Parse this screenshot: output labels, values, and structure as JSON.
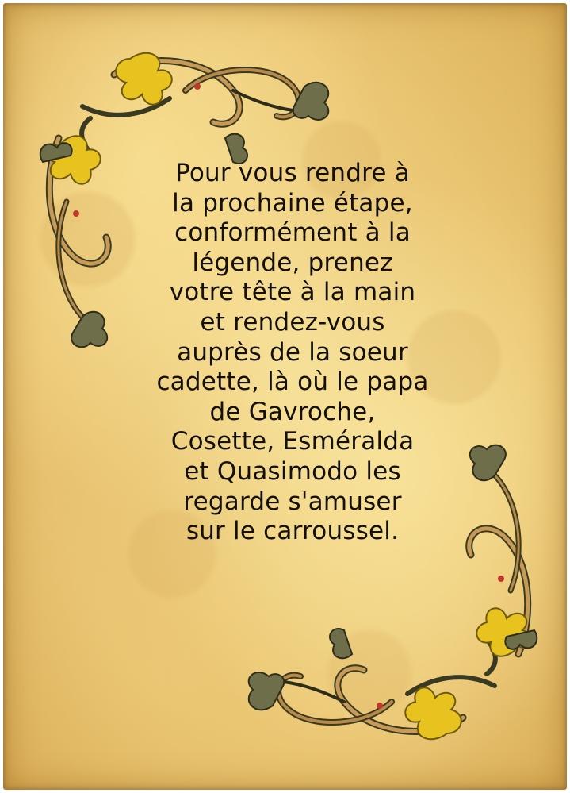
{
  "poem": {
    "lines": [
      "Pour vous rendre à",
      "la prochaine étape,",
      "conformément à la",
      "légende, prenez",
      "votre tête à la main",
      "et rendez-vous",
      "auprès de la soeur",
      "cadette, là où le papa",
      "de Gavroche,",
      "Cosette, Esméralda",
      "et Quasimodo les",
      "regarde s'amuser",
      "sur le carroussel."
    ]
  },
  "colors": {
    "parchment": "#ecc978",
    "text": "#141008",
    "ornament_gold": "#e8c21e",
    "ornament_brown": "#b88a4a",
    "ornament_dark": "#3a3a22",
    "ornament_leaf": "#6f6e4a"
  },
  "icons": {
    "top_left_decoration": "floral-scroll-ornament",
    "bottom_right_decoration": "floral-scroll-ornament"
  }
}
